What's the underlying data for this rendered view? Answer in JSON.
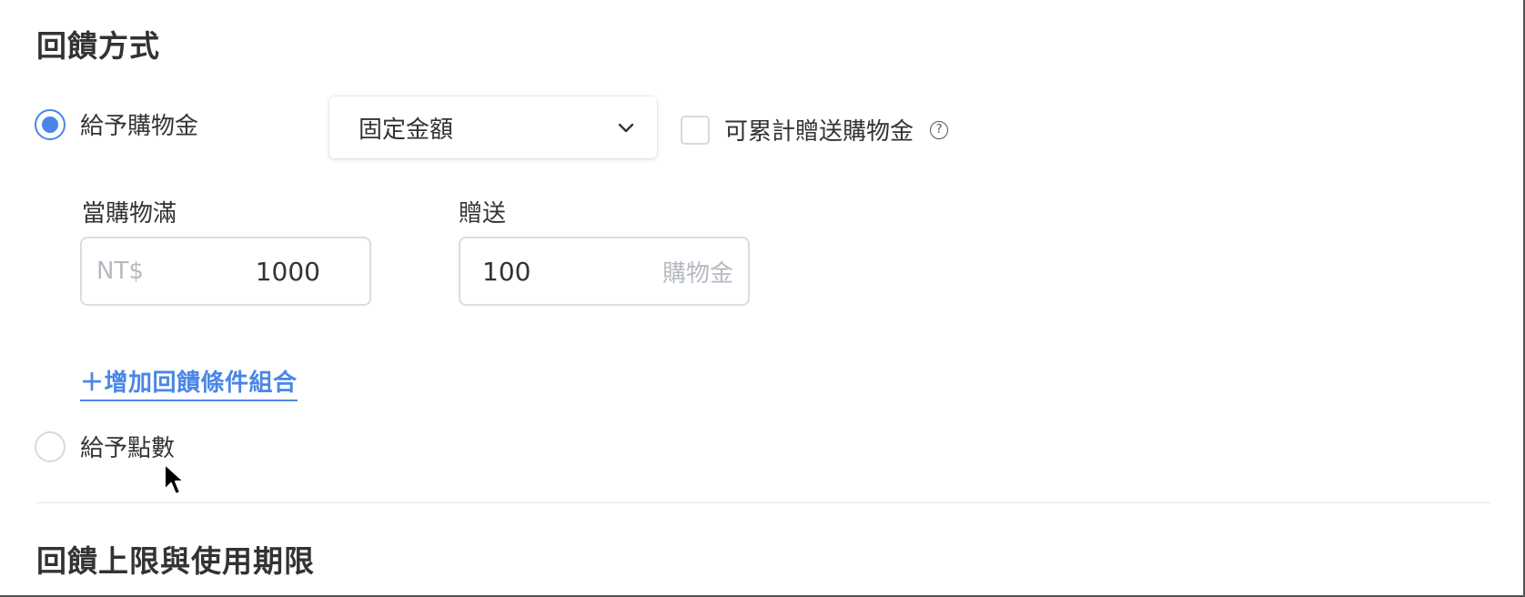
{
  "section1": {
    "title": "回饋方式"
  },
  "reward_options": {
    "store_credit": {
      "label": "給予購物金",
      "selected": true
    },
    "points": {
      "label": "給予點數",
      "selected": false
    }
  },
  "amount_type_select": {
    "value": "固定金額"
  },
  "cumulative_checkbox": {
    "label": "可累計贈送購物金",
    "checked": false,
    "help_glyph": "?"
  },
  "condition": {
    "min_purchase": {
      "label": "當購物滿",
      "prefix": "NT$",
      "value": "1000"
    },
    "gift": {
      "label": "贈送",
      "value": "100",
      "suffix": "購物金"
    }
  },
  "add_condition_link": {
    "label": "＋增加回饋條件組合"
  },
  "section2": {
    "title": "回饋上限與使用期限"
  },
  "colors": {
    "accent": "#4a86e8",
    "text": "#333333",
    "muted": "#b5bac2",
    "border": "#d9dde2"
  },
  "icons": {
    "select": "chevron-down-icon",
    "help": "question-circle-icon",
    "pointer": "mouse-cursor-icon"
  }
}
